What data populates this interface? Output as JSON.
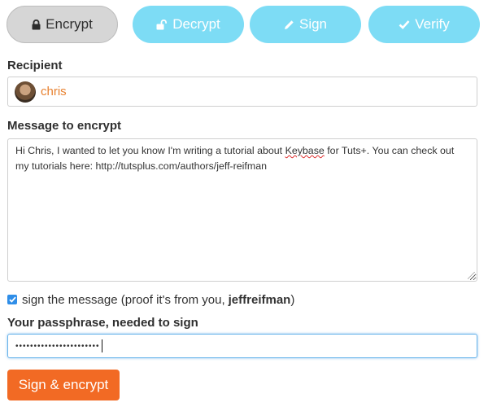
{
  "tabs": [
    {
      "label": "Encrypt",
      "icon": "lock-icon",
      "active": true
    },
    {
      "label": "Decrypt",
      "icon": "unlock-icon",
      "active": false
    },
    {
      "label": "Sign",
      "icon": "pencil-icon",
      "active": false
    },
    {
      "label": "Verify",
      "icon": "check-icon",
      "active": false
    }
  ],
  "recipient": {
    "label": "Recipient",
    "name": "chris"
  },
  "message": {
    "label": "Message to encrypt",
    "text_before": "Hi Chris, I wanted to let you know I'm writing a tutorial about ",
    "misspelled": "Keybase",
    "text_after": " for Tuts+. You can check out my tutorials here: http://tutsplus.com/authors/jeff-reifman"
  },
  "sign": {
    "checked": true,
    "label": "sign the message (proof it's from you,",
    "username": "jeffreifman",
    "closing": ")"
  },
  "passphrase": {
    "label": "Your passphrase, needed to sign",
    "masked_value": "•••••••••••••••••••••••"
  },
  "submit_label": "Sign & encrypt",
  "colors": {
    "active_tab_bg": "#d6d6d6",
    "inactive_tab_bg": "#7ddcf5",
    "recipient_name": "#e8812f",
    "submit_bg": "#f26a24",
    "checkbox": "#2f8ee8",
    "focus_border": "#67b3ea"
  }
}
